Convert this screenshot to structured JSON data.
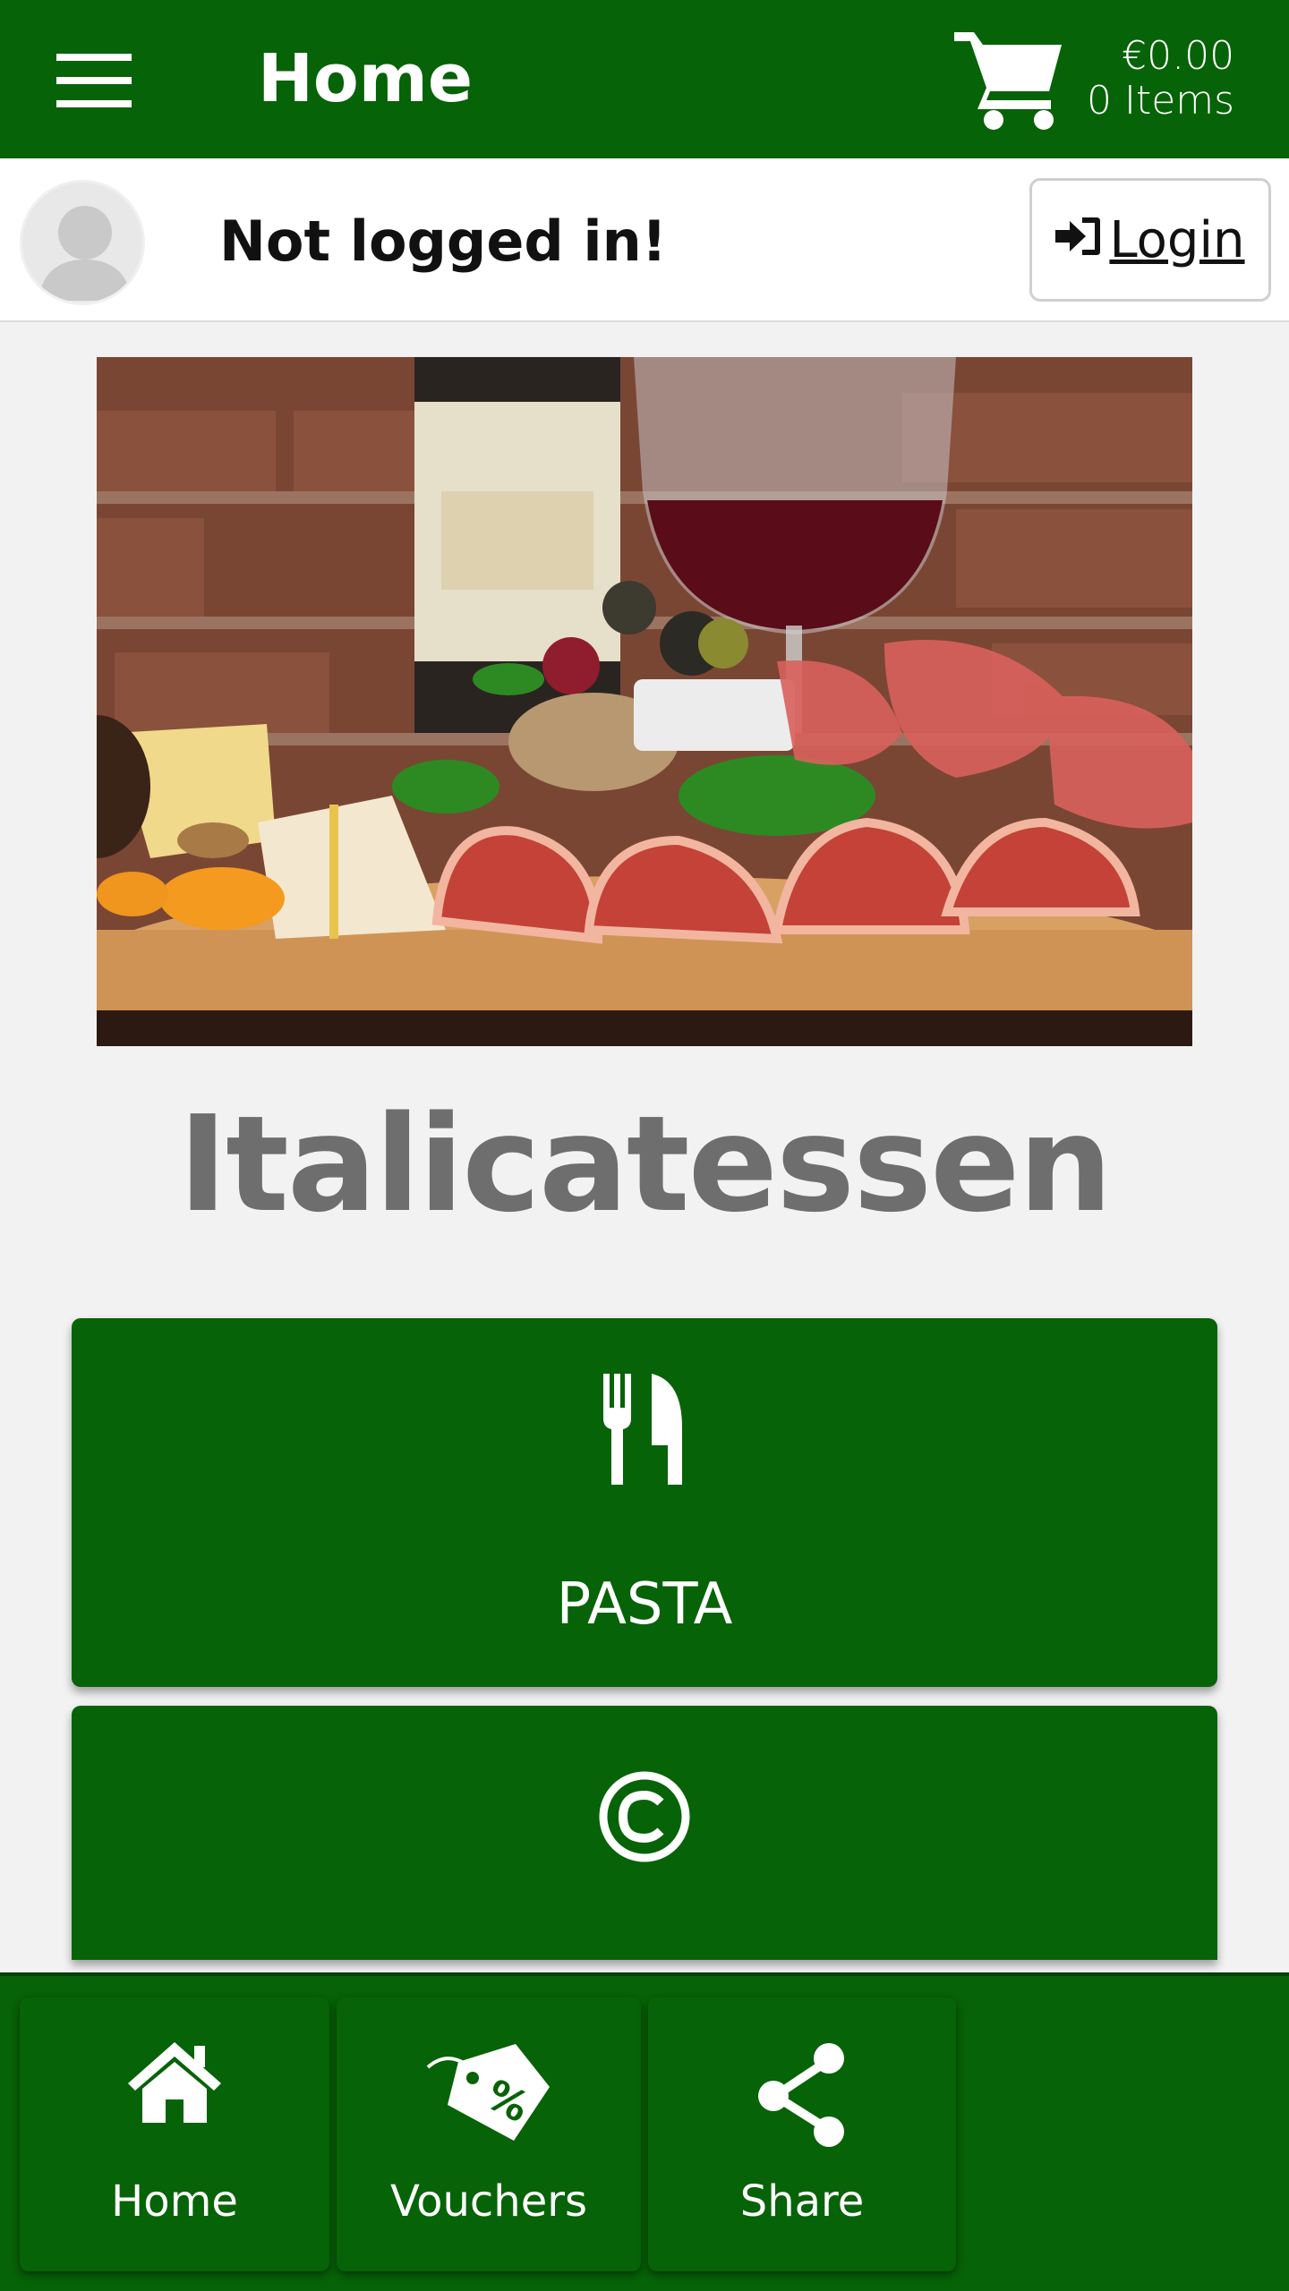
{
  "app_bar": {
    "title": "Home",
    "cart_total": "€0.00",
    "cart_items": "0 Items"
  },
  "user_bar": {
    "status": "Not logged in!",
    "login_label": "Login"
  },
  "shop": {
    "name": "Italicatessen"
  },
  "categories": [
    {
      "label": "PASTA",
      "icon": "cutlery-icon"
    },
    {
      "label": "",
      "icon": "copyright-icon"
    }
  ],
  "bottom_nav": [
    {
      "label": "Home",
      "icon": "home-icon"
    },
    {
      "label": "Vouchers",
      "icon": "voucher-tag-icon"
    },
    {
      "label": "Share",
      "icon": "share-icon"
    }
  ],
  "colors": {
    "primary_green": "#076307",
    "title_gray": "#6e6e6e",
    "background": "#f2f2f2"
  }
}
